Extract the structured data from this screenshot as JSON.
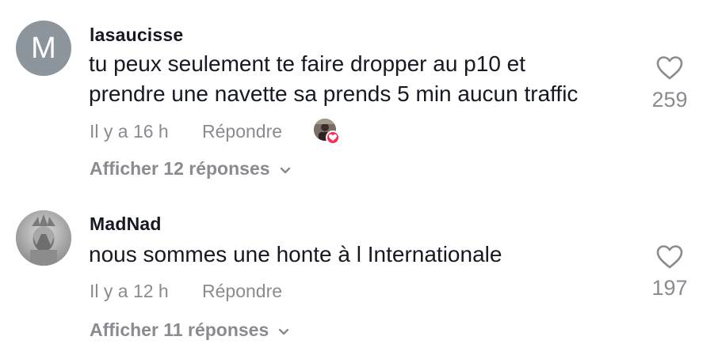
{
  "comments": [
    {
      "avatar_letter": "M",
      "username": "lasaucisse",
      "text_line1": "tu peux seulement te faire dropper au p10 et",
      "text_line2": "prendre une navette sa prends 5 min aucun traffic",
      "timestamp": "Il y a 16 h",
      "reply_label": "Répondre",
      "likes": "259",
      "view_replies": "Afficher 12 réponses",
      "creator_liked": true
    },
    {
      "avatar_letter": "",
      "username": "MadNad",
      "text_line1": "nous sommes une honte à l Internationale",
      "timestamp": "Il y a 12 h",
      "reply_label": "Répondre",
      "likes": "197",
      "view_replies": "Afficher 11 réponses",
      "creator_liked": false
    }
  ],
  "icons": {
    "like": "heart-outline-icon",
    "expand": "chevron-down-icon",
    "creator_like_badge": "heart-filled-icon"
  },
  "colors": {
    "text_primary": "#161823",
    "text_secondary": "#8a8b91",
    "avatar_letter_bg": "#8d959c",
    "like_badge": "#fe2c55"
  }
}
